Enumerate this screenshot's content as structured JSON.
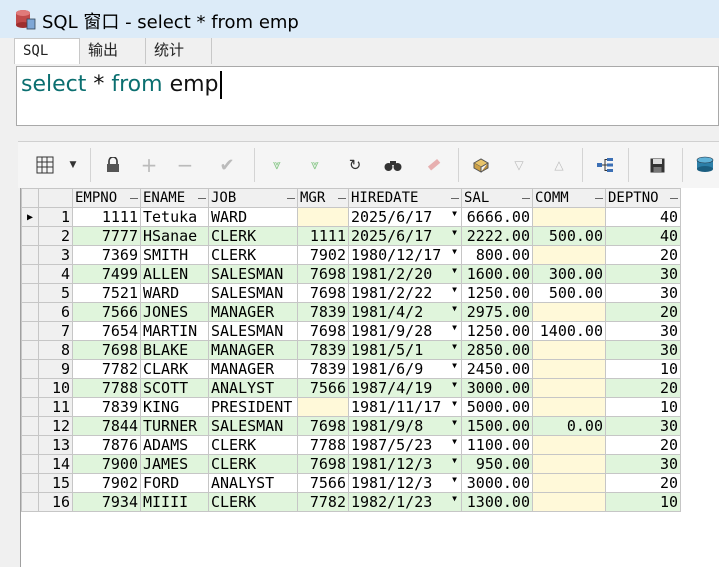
{
  "window": {
    "title": "SQL 窗口 - select * from emp"
  },
  "tabs": [
    {
      "label": "SQL"
    },
    {
      "label": "输出"
    },
    {
      "label": "统计"
    }
  ],
  "editor": {
    "keyword_select": "select",
    "star": " * ",
    "keyword_from": "from",
    "table": " emp"
  },
  "toolbar": {
    "icons": [
      "grid-view-icon",
      "dropdown-icon",
      "lock-icon",
      "add-record-icon",
      "remove-record-icon",
      "post-icon",
      "fetch-next-icon",
      "fetch-last-icon",
      "refresh-icon",
      "find-icon",
      "clear-icon",
      "export-icon",
      "filter-down-icon",
      "filter-up-icon",
      "tree-icon",
      "save-icon",
      "print-icon"
    ]
  },
  "grid": {
    "columns": [
      "EMPNO",
      "ENAME",
      "JOB",
      "MGR",
      "HIREDATE",
      "SAL",
      "COMM",
      "DEPTNO"
    ],
    "rows": [
      {
        "n": "1",
        "empno": "1111",
        "ename": "Tetuka",
        "job": "WARD",
        "mgr": "",
        "hiredate": "2025/6/17",
        "sal": "6666.00",
        "comm": "",
        "deptno": "40"
      },
      {
        "n": "2",
        "empno": "7777",
        "ename": "HSanae",
        "job": "CLERK",
        "mgr": "1111",
        "hiredate": "2025/6/17",
        "sal": "2222.00",
        "comm": "500.00",
        "deptno": "40"
      },
      {
        "n": "3",
        "empno": "7369",
        "ename": "SMITH",
        "job": "CLERK",
        "mgr": "7902",
        "hiredate": "1980/12/17",
        "sal": "800.00",
        "comm": "",
        "deptno": "20"
      },
      {
        "n": "4",
        "empno": "7499",
        "ename": "ALLEN",
        "job": "SALESMAN",
        "mgr": "7698",
        "hiredate": "1981/2/20",
        "sal": "1600.00",
        "comm": "300.00",
        "deptno": "30"
      },
      {
        "n": "5",
        "empno": "7521",
        "ename": "WARD",
        "job": "SALESMAN",
        "mgr": "7698",
        "hiredate": "1981/2/22",
        "sal": "1250.00",
        "comm": "500.00",
        "deptno": "30"
      },
      {
        "n": "6",
        "empno": "7566",
        "ename": "JONES",
        "job": "MANAGER",
        "mgr": "7839",
        "hiredate": "1981/4/2",
        "sal": "2975.00",
        "comm": "",
        "deptno": "20"
      },
      {
        "n": "7",
        "empno": "7654",
        "ename": "MARTIN",
        "job": "SALESMAN",
        "mgr": "7698",
        "hiredate": "1981/9/28",
        "sal": "1250.00",
        "comm": "1400.00",
        "deptno": "30"
      },
      {
        "n": "8",
        "empno": "7698",
        "ename": "BLAKE",
        "job": "MANAGER",
        "mgr": "7839",
        "hiredate": "1981/5/1",
        "sal": "2850.00",
        "comm": "",
        "deptno": "30"
      },
      {
        "n": "9",
        "empno": "7782",
        "ename": "CLARK",
        "job": "MANAGER",
        "mgr": "7839",
        "hiredate": "1981/6/9",
        "sal": "2450.00",
        "comm": "",
        "deptno": "10"
      },
      {
        "n": "10",
        "empno": "7788",
        "ename": "SCOTT",
        "job": "ANALYST",
        "mgr": "7566",
        "hiredate": "1987/4/19",
        "sal": "3000.00",
        "comm": "",
        "deptno": "20"
      },
      {
        "n": "11",
        "empno": "7839",
        "ename": "KING",
        "job": "PRESIDENT",
        "mgr": "",
        "hiredate": "1981/11/17",
        "sal": "5000.00",
        "comm": "",
        "deptno": "10"
      },
      {
        "n": "12",
        "empno": "7844",
        "ename": "TURNER",
        "job": "SALESMAN",
        "mgr": "7698",
        "hiredate": "1981/9/8",
        "sal": "1500.00",
        "comm": "0.00",
        "deptno": "30"
      },
      {
        "n": "13",
        "empno": "7876",
        "ename": "ADAMS",
        "job": "CLERK",
        "mgr": "7788",
        "hiredate": "1987/5/23",
        "sal": "1100.00",
        "comm": "",
        "deptno": "20"
      },
      {
        "n": "14",
        "empno": "7900",
        "ename": "JAMES",
        "job": "CLERK",
        "mgr": "7698",
        "hiredate": "1981/12/3",
        "sal": "950.00",
        "comm": "",
        "deptno": "30"
      },
      {
        "n": "15",
        "empno": "7902",
        "ename": "FORD",
        "job": "ANALYST",
        "mgr": "7566",
        "hiredate": "1981/12/3",
        "sal": "3000.00",
        "comm": "",
        "deptno": "20"
      },
      {
        "n": "16",
        "empno": "7934",
        "ename": "MIIII",
        "job": "CLERK",
        "mgr": "7782",
        "hiredate": "1982/1/23",
        "sal": "1300.00",
        "comm": "",
        "deptno": "10"
      }
    ]
  },
  "colors": {
    "row_alt": "#e0f5dc",
    "null_cell": "#fff9d9",
    "keyword": "#0b6f70",
    "titlebar": "#dcebf8"
  }
}
